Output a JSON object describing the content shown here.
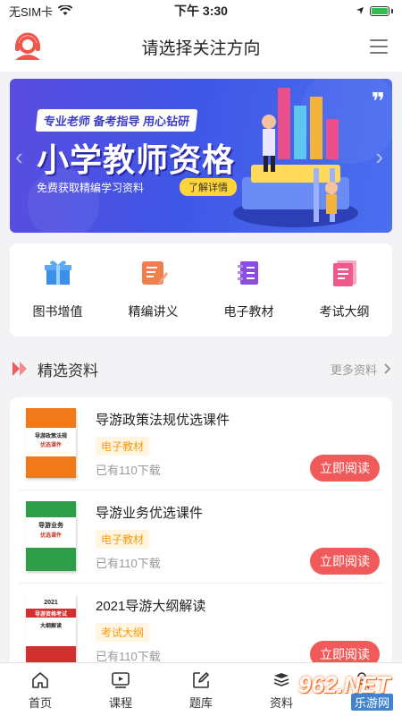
{
  "status_bar": {
    "carrier": "无SIM卡",
    "time": "下午 3:30"
  },
  "header": {
    "title": "请选择关注方向"
  },
  "banner": {
    "tagline": "专业老师 备考指导 用心钻研",
    "title": "小学教师资格",
    "subtitle": "免费获取精编学习资料",
    "button": "了解详情"
  },
  "categories": [
    {
      "label": "图书增值",
      "icon": "gift-icon"
    },
    {
      "label": "精编讲义",
      "icon": "notes-icon"
    },
    {
      "label": "电子教材",
      "icon": "ebook-icon"
    },
    {
      "label": "考试大纲",
      "icon": "outline-icon"
    }
  ],
  "section": {
    "title": "精选资料",
    "more": "更多资料"
  },
  "items": [
    {
      "title": "导游政策法规优选课件",
      "tag": "电子教材",
      "downloads": "已有110下载",
      "button": "立即阅读",
      "cover_text": "导游政策法规",
      "cover_sub": "优选课件"
    },
    {
      "title": "导游业务优选课件",
      "tag": "电子教材",
      "downloads": "已有110下载",
      "button": "立即阅读",
      "cover_text": "导游业务",
      "cover_sub": "优选课件"
    },
    {
      "title": "2021导游大纲解读",
      "tag": "考试大纲",
      "downloads": "已有110下载",
      "button": "立即阅读",
      "cover_text": "导游资格考试",
      "cover_sub": "大纲解读",
      "cover_year": "2021"
    }
  ],
  "tabbar": [
    {
      "label": "首页",
      "icon": "home-icon"
    },
    {
      "label": "课程",
      "icon": "play-icon"
    },
    {
      "label": "题库",
      "icon": "edit-icon"
    },
    {
      "label": "资料",
      "icon": "stack-icon"
    }
  ],
  "watermark": {
    "top": "962.NET",
    "bottom": "乐游网"
  },
  "colors": {
    "accent_red": "#f05a5a",
    "tag_orange": "#f39c12",
    "banner_blue": "#4b56e6"
  }
}
